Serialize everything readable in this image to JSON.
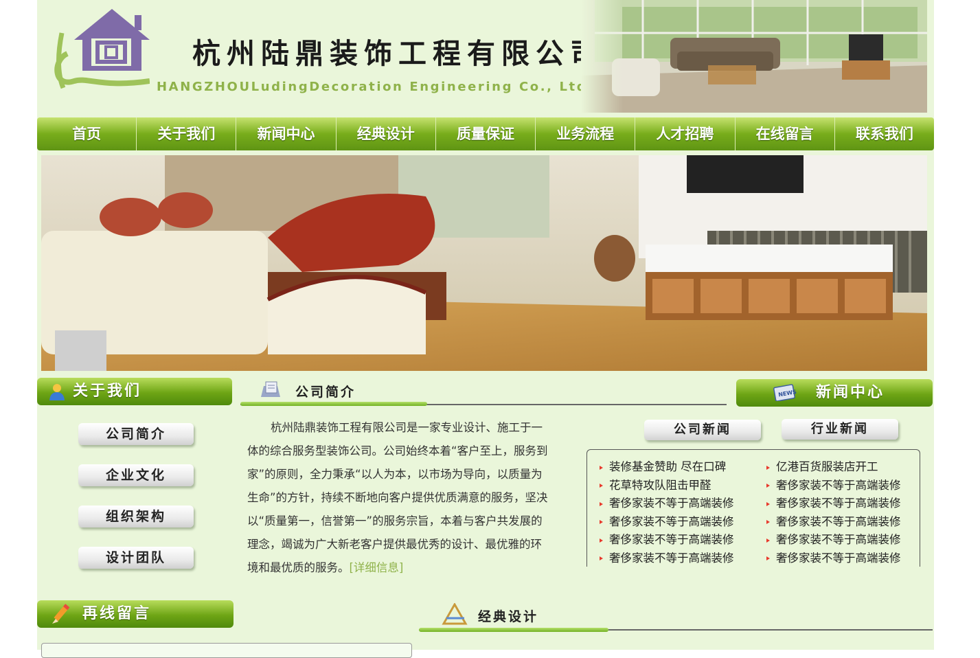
{
  "header": {
    "company_cn": "杭州陆鼎装饰工程有限公司",
    "company_en": "HANGZHOULudingDecoration Engineering Co., Ltd"
  },
  "nav": {
    "items": [
      "首页",
      "关于我们",
      "新闻中心",
      "经典设计",
      "质量保证",
      "业务流程",
      "人才招聘",
      "在线留言",
      "联系我们"
    ]
  },
  "about": {
    "title": "关于我们",
    "buttons": [
      "公司简介",
      "企业文化",
      "组织架构",
      "设计团队"
    ]
  },
  "intro": {
    "title": "公司简介",
    "body": "杭州陆鼎装饰工程有限公司是一家专业设计、施工于一体的综合服务型装饰公司。公司始终本着“客户至上，服务到家”的原则，全力秉承“以人为本，以市场为导向，以质量为生命”的方针，持续不断地向客户提供优质满意的服务，坚决以“质量第一，信誉第一”的服务宗旨，本着与客户共发展的理念，竭诚为广大新老客户提供最优秀的设计、最优雅的环境和最优质的服务。",
    "more": "[详细信息]"
  },
  "news": {
    "title": "新闻中心",
    "tabs": [
      "公司新闻",
      "行业新闻"
    ],
    "company_news": [
      "装修基金赞助 尽在口碑",
      "花草特攻队阻击甲醛",
      "奢侈家装不等于高端装修",
      "奢侈家装不等于高端装修",
      "奢侈家装不等于高端装修",
      "奢侈家装不等于高端装修"
    ],
    "industry_news": [
      "亿港百货服装店开工",
      "奢侈家装不等于高端装修",
      "奢侈家装不等于高端装修",
      "奢侈家装不等于高端装修",
      "奢侈家装不等于高端装修",
      "奢侈家装不等于高端装修"
    ]
  },
  "message": {
    "title": "再线留言"
  },
  "design": {
    "title": "经典设计"
  },
  "colors": {
    "nav_green": "#78ad1b",
    "bg": "#eaf6da",
    "accent_text": "#8fb24a",
    "bullet": "#e8392c"
  }
}
